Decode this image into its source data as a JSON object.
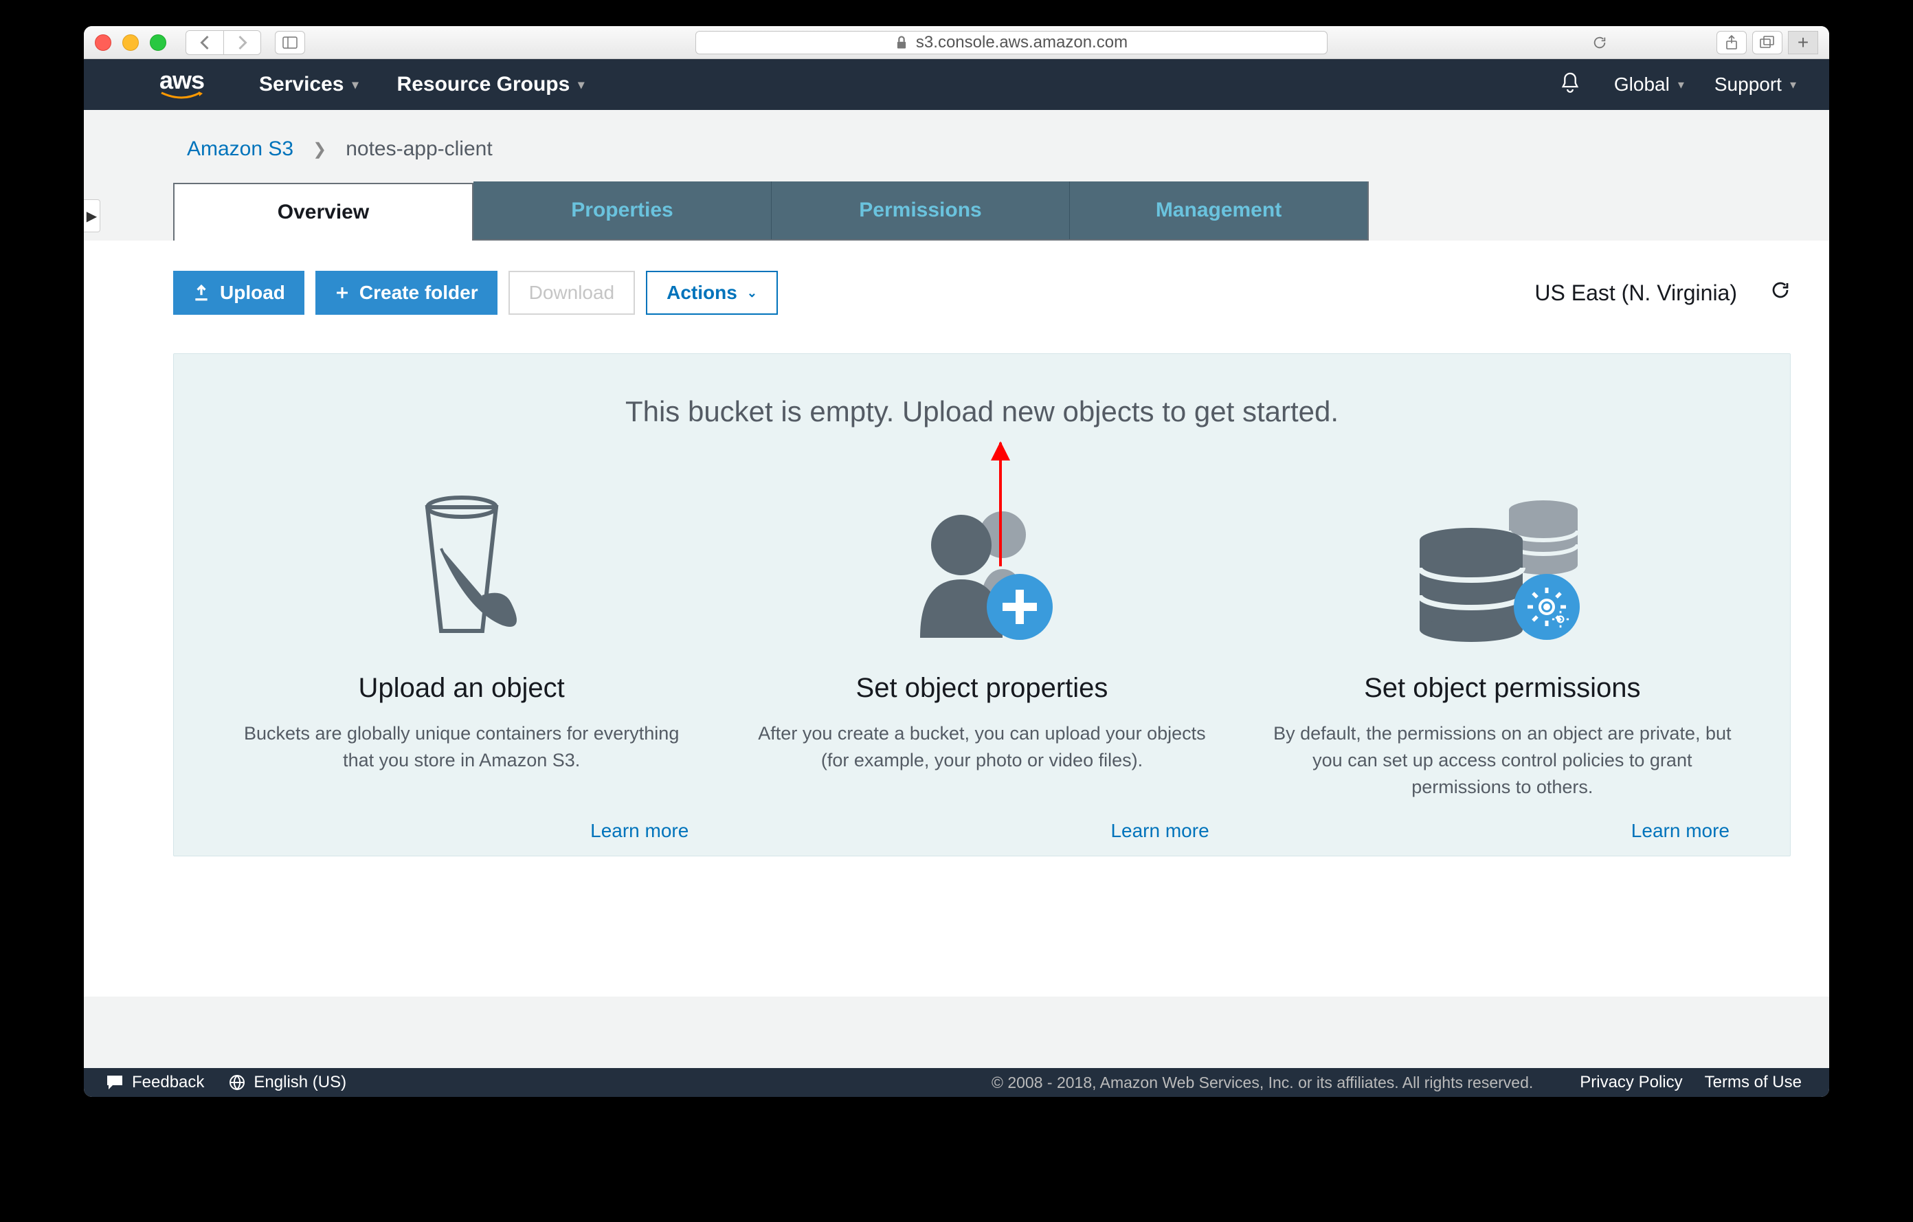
{
  "browser": {
    "url": "s3.console.aws.amazon.com"
  },
  "nav": {
    "services": "Services",
    "resource_groups": "Resource Groups",
    "region": "Global",
    "support": "Support"
  },
  "breadcrumb": {
    "root": "Amazon S3",
    "bucket": "notes-app-client"
  },
  "tabs": {
    "overview": "Overview",
    "properties": "Properties",
    "permissions": "Permissions",
    "management": "Management"
  },
  "toolbar": {
    "upload": "Upload",
    "create_folder": "Create folder",
    "download": "Download",
    "actions": "Actions",
    "region_label": "US East (N. Virginia)"
  },
  "empty": {
    "headline": "This bucket is empty. Upload new objects to get started.",
    "cards": [
      {
        "title": "Upload an object",
        "desc": "Buckets are globally unique containers for everything that you store in Amazon S3.",
        "link": "Learn more"
      },
      {
        "title": "Set object properties",
        "desc": "After you create a bucket, you can upload your objects (for example, your photo or video files).",
        "link": "Learn more"
      },
      {
        "title": "Set object permissions",
        "desc": "By default, the permissions on an object are private, but you can set up access control policies to grant permissions to others.",
        "link": "Learn more"
      }
    ]
  },
  "footer": {
    "feedback": "Feedback",
    "language": "English (US)",
    "copyright": "© 2008 - 2018, Amazon Web Services, Inc. or its affiliates. All rights reserved.",
    "privacy": "Privacy Policy",
    "terms": "Terms of Use"
  }
}
